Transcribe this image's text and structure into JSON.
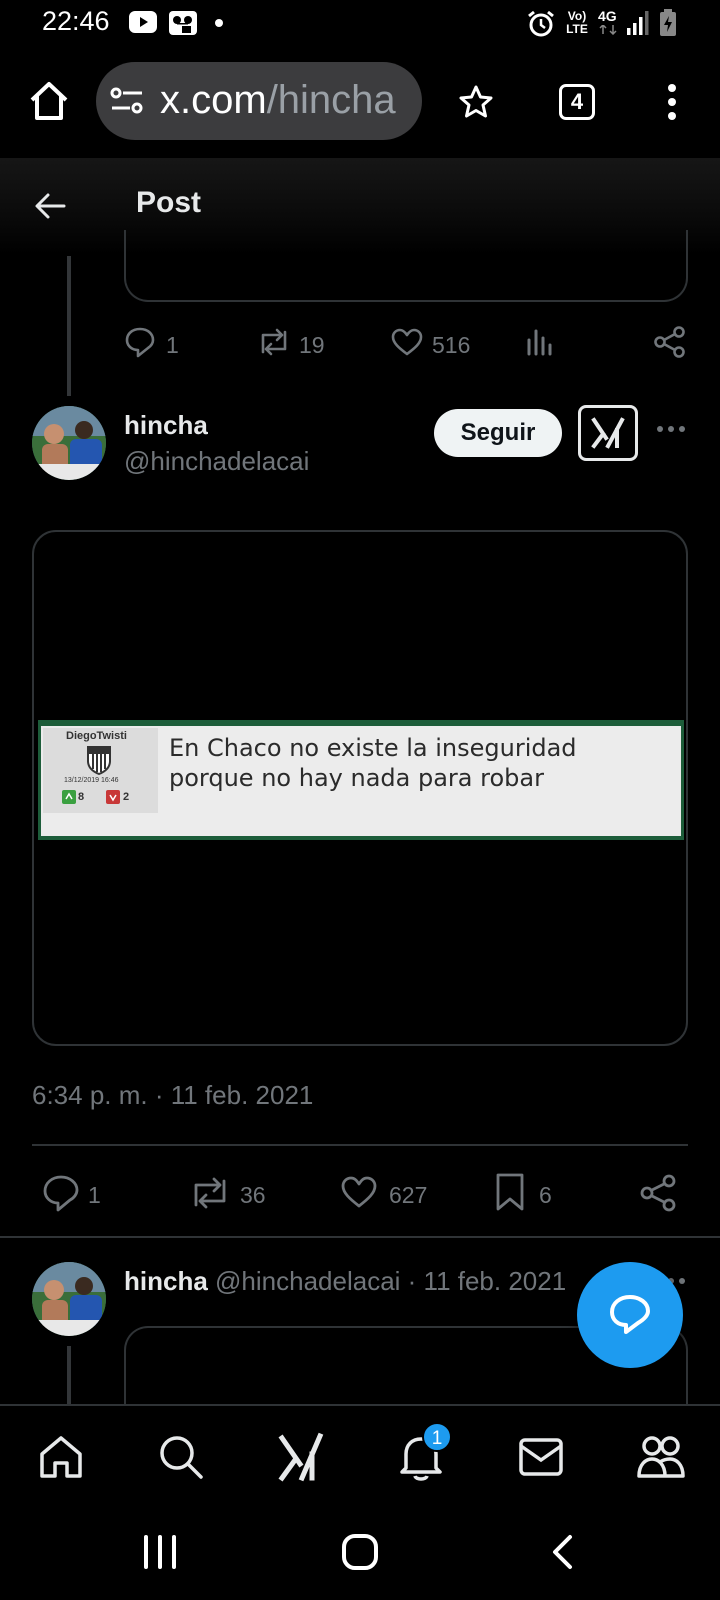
{
  "status_bar": {
    "time": "22:46",
    "network_label": "Vo) LTE",
    "network_type": "4G"
  },
  "browser": {
    "url_host": "x.com",
    "url_path": "/hincha",
    "tab_count": "4"
  },
  "header": {
    "title": "Post"
  },
  "previous_post": {
    "replies": "1",
    "reposts": "19",
    "likes": "516"
  },
  "main_post": {
    "display_name": "hincha",
    "handle": "@hinchadelacai",
    "follow_label": "Seguir",
    "embed": {
      "username": "DiegoTwisti",
      "date": "13/12/2019 16:46",
      "upvotes": "8",
      "downvotes": "2",
      "text_line1": "En Chaco no existe la inseguridad",
      "text_line2": "porque no hay nada para robar"
    },
    "timestamp": "6:34 p. m. · 11 feb. 2021",
    "replies": "1",
    "reposts": "36",
    "likes": "627",
    "bookmarks": "6"
  },
  "reply_post": {
    "display_name": "hincha",
    "handle_and_date": "@hinchadelacai · 11 feb. 2021"
  },
  "bottom_nav": {
    "notification_count": "1"
  },
  "colors": {
    "background": "#000000",
    "accent": "#1d9bf0",
    "text_primary": "#e7e9ea",
    "text_secondary": "#71767b",
    "border": "#2f3336"
  }
}
